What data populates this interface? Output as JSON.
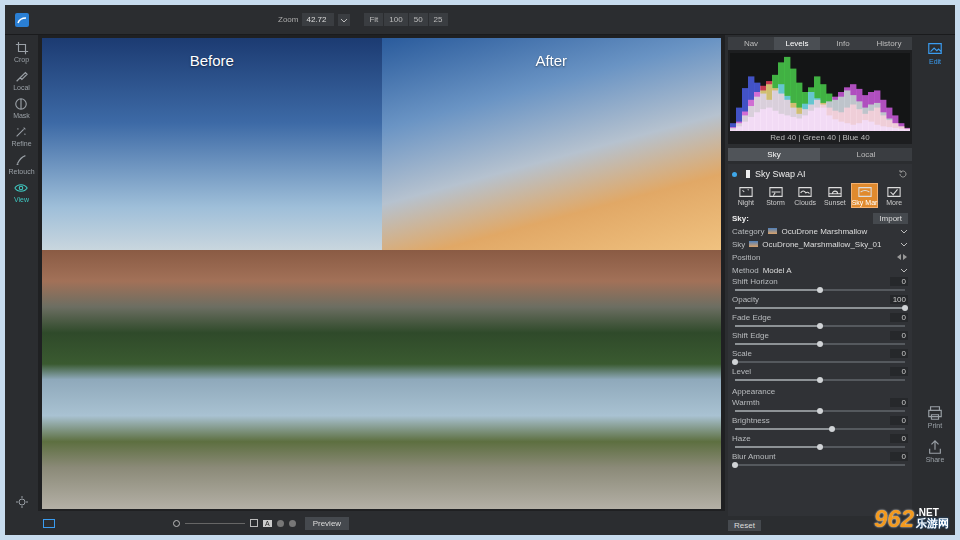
{
  "window": {
    "zoom_label": "Zoom",
    "zoom_value": "42.72",
    "zoom_options": [
      "Fit",
      "100",
      "50",
      "25"
    ]
  },
  "tools": [
    {
      "label": "Crop",
      "selected": false
    },
    {
      "label": "Local",
      "selected": false
    },
    {
      "label": "Mask",
      "selected": false
    },
    {
      "label": "Refine",
      "selected": false
    },
    {
      "label": "Retouch",
      "selected": false
    },
    {
      "label": "View",
      "selected": true
    }
  ],
  "help": "?",
  "canvas": {
    "before": "Before",
    "after": "After"
  },
  "panel_tabs": [
    {
      "label": "Nav",
      "selected": false
    },
    {
      "label": "Levels",
      "selected": true
    },
    {
      "label": "Info",
      "selected": false
    },
    {
      "label": "History",
      "selected": false
    }
  ],
  "histogram": {
    "readout": "Red 40 | Green 40 | Blue 40",
    "series": [
      {
        "name": "blue",
        "color": "#3b4fe0",
        "values": [
          10,
          30,
          55,
          70,
          62,
          48,
          40,
          52,
          60,
          45,
          30,
          22,
          35,
          50,
          42,
          30,
          20,
          15,
          12,
          10,
          8,
          10,
          14,
          12,
          8,
          6,
          5,
          4,
          3,
          2
        ]
      },
      {
        "name": "red",
        "color": "#e0304a",
        "values": [
          5,
          12,
          25,
          40,
          50,
          58,
          64,
          55,
          48,
          40,
          36,
          30,
          28,
          34,
          40,
          36,
          30,
          26,
          24,
          30,
          34,
          28,
          22,
          26,
          30,
          20,
          14,
          10,
          6,
          3
        ]
      },
      {
        "name": "green",
        "color": "#39c83a",
        "values": [
          4,
          10,
          20,
          32,
          44,
          52,
          60,
          72,
          88,
          95,
          80,
          62,
          50,
          56,
          70,
          60,
          48,
          40,
          44,
          52,
          46,
          38,
          30,
          34,
          36,
          24,
          16,
          10,
          6,
          3
        ]
      },
      {
        "name": "magenta",
        "color": "#c64ad8",
        "values": [
          2,
          6,
          12,
          18,
          24,
          28,
          30,
          26,
          22,
          20,
          18,
          16,
          20,
          26,
          30,
          34,
          38,
          44,
          50,
          56,
          60,
          54,
          46,
          50,
          52,
          40,
          30,
          20,
          10,
          4
        ]
      }
    ]
  },
  "sub_tabs": [
    {
      "label": "Sky",
      "selected": true
    },
    {
      "label": "Local",
      "selected": false
    }
  ],
  "filter": {
    "title": "Sky Swap AI"
  },
  "presets": [
    {
      "label": "Night",
      "selected": false
    },
    {
      "label": "Storm",
      "selected": false
    },
    {
      "label": "Clouds",
      "selected": false
    },
    {
      "label": "Sunset",
      "selected": false
    },
    {
      "label": "Sky Mar",
      "selected": true
    },
    {
      "label": "More",
      "selected": false
    }
  ],
  "sky": {
    "label": "Sky:",
    "import": "Import",
    "category_label": "Category",
    "category": "OcuDrone Marshmallow",
    "sky_label": "Sky",
    "sky_value": "OcuDrone_Marshmallow_Sky_01"
  },
  "position": {
    "title": "Position",
    "method_label": "Method",
    "method": "Model A"
  },
  "position_sliders": [
    {
      "label": "Shift Horizon",
      "value": "0",
      "level": 0.5
    },
    {
      "label": "Opacity",
      "value": "100",
      "level": 1.0
    },
    {
      "label": "Fade Edge",
      "value": "0",
      "level": 0.5
    },
    {
      "label": "Shift Edge",
      "value": "0",
      "level": 0.5
    },
    {
      "label": "Scale",
      "value": "0",
      "level": 0.0
    },
    {
      "label": "Level",
      "value": "0",
      "level": 0.5
    }
  ],
  "appearance": {
    "title": "Appearance"
  },
  "appearance_sliders": [
    {
      "label": "Warmth",
      "value": "0",
      "level": 0.5
    },
    {
      "label": "Brightness",
      "value": "0",
      "level": 0.57
    },
    {
      "label": "Haze",
      "value": "0",
      "level": 0.5
    },
    {
      "label": "Blur Amount",
      "value": "0",
      "level": 0.0
    }
  ],
  "footer": {
    "reset": "Reset"
  },
  "right_nav": [
    {
      "label": "Edit",
      "selected": true
    },
    {
      "label": "Print",
      "selected": false
    },
    {
      "label": "Share",
      "selected": false
    }
  ],
  "bottom_bar": {
    "preview": "Preview",
    "toggle": "A"
  },
  "watermark": {
    "number": "962",
    "domain": ".NET",
    "site": "乐游网"
  }
}
